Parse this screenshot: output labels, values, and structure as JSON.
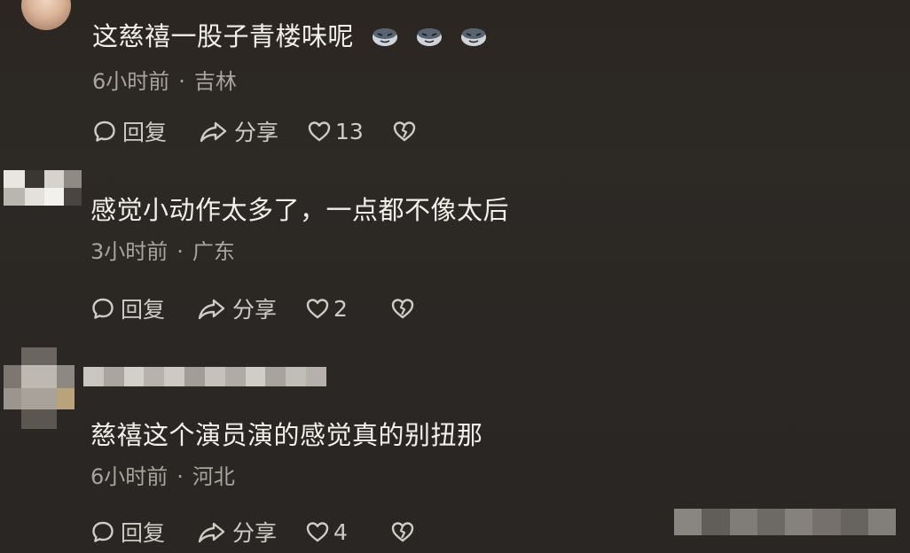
{
  "comments": [
    {
      "text": "这慈禧一股子青楼味呢",
      "emojis": [
        "smirk-emoji",
        "smirk-emoji",
        "smirk-emoji"
      ],
      "time": "6小时前",
      "separator": "·",
      "location": "吉林",
      "reply_label": "回复",
      "share_label": "分享",
      "likes": "13"
    },
    {
      "text": "感觉小动作太多了，一点都不像太后",
      "time": "3小时前",
      "separator": "·",
      "location": "广东",
      "reply_label": "回复",
      "share_label": "分享",
      "likes": "2"
    },
    {
      "text": "慈禧这个演员演的感觉真的别扭那",
      "time": "6小时前",
      "separator": "·",
      "location": "河北",
      "reply_label": "回复",
      "share_label": "分享",
      "likes": "4"
    }
  ],
  "icons": {
    "reply": "comment-bubble-icon",
    "share": "share-arrow-icon",
    "like": "heart-icon",
    "dislike": "broken-heart-icon"
  },
  "colors": {
    "background": "#2a2623",
    "text_primary": "#f2efea",
    "text_meta": "#a9a49d",
    "action": "#cfcbc5"
  }
}
